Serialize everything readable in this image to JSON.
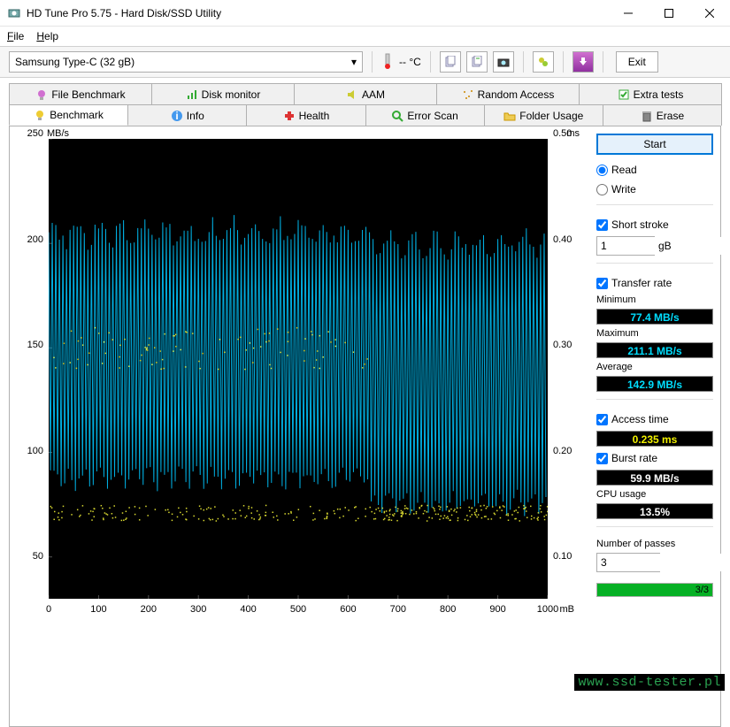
{
  "window": {
    "title": "HD Tune Pro 5.75 - Hard Disk/SSD Utility"
  },
  "menu": {
    "file": "File",
    "help": "Help"
  },
  "toolbar": {
    "drive": "Samsung Type-C (32 gB)",
    "temp": "-- °C",
    "exit": "Exit"
  },
  "tabs_row1": [
    {
      "label": "File Benchmark"
    },
    {
      "label": "Disk monitor"
    },
    {
      "label": "AAM"
    },
    {
      "label": "Random Access"
    },
    {
      "label": "Extra tests"
    }
  ],
  "tabs_row2": [
    {
      "label": "Benchmark"
    },
    {
      "label": "Info"
    },
    {
      "label": "Health"
    },
    {
      "label": "Error Scan"
    },
    {
      "label": "Folder Usage"
    },
    {
      "label": "Erase"
    }
  ],
  "chart_data": {
    "type": "line",
    "x_unit": "mB",
    "y_left_unit": "MB/s",
    "y_right_unit": "ms",
    "x_ticks": [
      0,
      100,
      200,
      300,
      400,
      500,
      600,
      700,
      800,
      900,
      1000
    ],
    "y_left_ticks": [
      50,
      100,
      150,
      200,
      250
    ],
    "y_right_ticks": [
      0.1,
      0.2,
      0.3,
      0.4,
      0.5
    ],
    "y_left_range": [
      30,
      250
    ],
    "y_right_range": [
      0.06,
      0.5
    ],
    "series": [
      {
        "name": "transfer_rate",
        "color": "#00aee0",
        "y_axis": "left",
        "style": "spiky",
        "approx_min": 77,
        "approx_max": 211,
        "approx_mean": 143,
        "note": "densely oscillating; right half slightly lower low-band (~75) vs left (~85)"
      },
      {
        "name": "access_time",
        "color": "#d8d830",
        "y_axis": "right",
        "style": "scatter",
        "approx_band": [
          0.13,
          0.15
        ],
        "secondary_cluster": [
          0.28,
          0.32
        ],
        "secondary_cluster_x_range": [
          0,
          640
        ]
      }
    ]
  },
  "controls": {
    "start": "Start",
    "read": "Read",
    "write": "Write",
    "short_stroke": "Short stroke",
    "short_stroke_val": "1",
    "short_stroke_unit": "gB",
    "transfer_rate": "Transfer rate",
    "min_label": "Minimum",
    "min_val": "77.4 MB/s",
    "max_label": "Maximum",
    "max_val": "211.1 MB/s",
    "avg_label": "Average",
    "avg_val": "142.9 MB/s",
    "access_time": "Access time",
    "access_val": "0.235 ms",
    "burst_rate": "Burst rate",
    "burst_val": "59.9 MB/s",
    "cpu_label": "CPU usage",
    "cpu_val": "13.5%",
    "passes_label": "Number of passes",
    "passes_val": "3",
    "progress_text": "3/3",
    "progress_pct": 100
  },
  "watermark": "www.ssd-tester.pl"
}
